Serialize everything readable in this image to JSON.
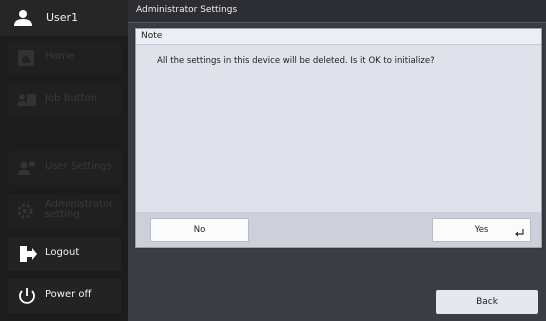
{
  "sidebar": {
    "user": {
      "label": "User1",
      "icon": "user-icon"
    },
    "items": [
      {
        "label": "Home",
        "icon": "home-icon",
        "state": "disabled"
      },
      {
        "label": "Job Button",
        "icon": "job-button-icon",
        "state": "disabled"
      },
      {
        "label": "User Settings",
        "icon": "user-settings-icon",
        "state": "disabled"
      },
      {
        "label": "Administrator setting",
        "icon": "gear-icon",
        "state": "disabled"
      },
      {
        "label": "Logout",
        "icon": "logout-icon",
        "state": "active"
      },
      {
        "label": "Power off",
        "icon": "power-icon",
        "state": "active"
      }
    ]
  },
  "main": {
    "title": "Administrator Settings",
    "back_label": "Back"
  },
  "dialog": {
    "title": "Note",
    "message": "All the settings in this device will be deleted. Is it OK to initialize?",
    "no_label": "No",
    "yes_label": "Yes",
    "yes_icon": "enter-icon"
  },
  "colors": {
    "sidebar_bg": "#1c1c1c",
    "main_bg": "#3b3d44",
    "dialog_bg": "#dfe2eb",
    "button_bg": "#fbfbfc",
    "back_button_bg": "#e6e8ef"
  }
}
